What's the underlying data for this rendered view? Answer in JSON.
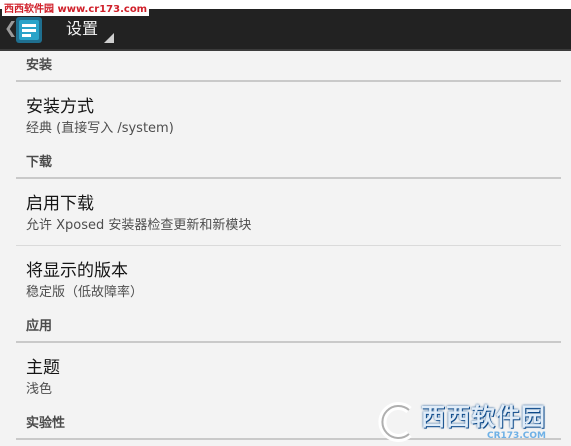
{
  "watermark": {
    "top_text": "西西软件园 www.cr173.com",
    "logo_text": "西西软件园",
    "logo_url": "CR173.COM"
  },
  "actionbar": {
    "up_glyph": "❮",
    "title": "设置"
  },
  "sections": [
    {
      "label": "安装",
      "items": [
        {
          "title": "安装方式",
          "summary": "经典 (直接写入 /system)"
        }
      ]
    },
    {
      "label": "下载",
      "items": [
        {
          "title": "启用下载",
          "summary": "允许 Xposed 安装器检查更新和新模块"
        },
        {
          "title": "将显示的版本",
          "summary": "稳定版（低故障率）"
        }
      ]
    },
    {
      "label": "应用",
      "items": [
        {
          "title": "主题",
          "summary": "浅色"
        }
      ]
    },
    {
      "label": "实验性",
      "items": []
    }
  ],
  "colors": {
    "actionbar_bg": "#222222",
    "background": "#f3f3f3",
    "divider": "#c9c9c9",
    "watermark_red": "#d0202a"
  }
}
